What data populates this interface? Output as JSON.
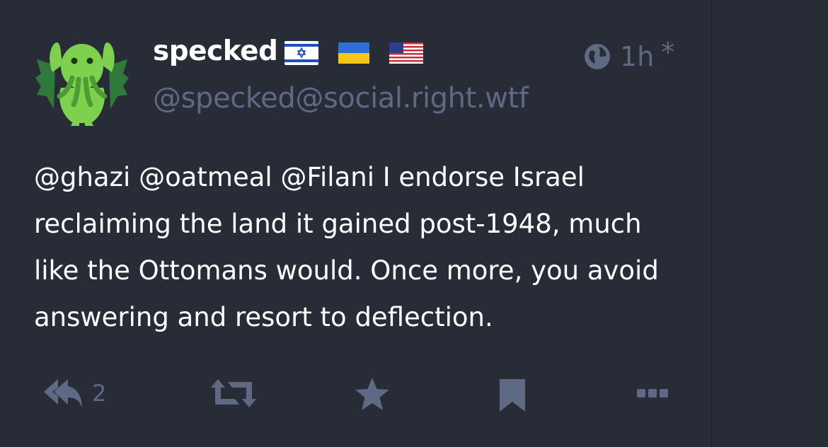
{
  "status": {
    "author": {
      "display_name": "specked",
      "handle": "@specked@social.right.wtf",
      "avatar_icon": "cthulhu-avatar",
      "flags": [
        "israel-flag",
        "ukraine-flag",
        "us-flag"
      ]
    },
    "visibility_icon": "globe-icon",
    "time": "1h",
    "edited_marker": "*",
    "mentions": [
      "@ghazi",
      "@oatmeal",
      "@Filani"
    ],
    "text": "I endorse Israel reclaiming the land it gained post-1948, much like the Ottomans would. Once more, you avoid answering and resort to deflection.",
    "reply_count": "2"
  },
  "actions": [
    "reply-icon",
    "boost-icon",
    "favourite-icon",
    "bookmark-icon",
    "more-icon"
  ],
  "colors": {
    "background": "#282c37",
    "text": "#ffffff",
    "muted": "#606984",
    "avatar_green": "#7ed04f"
  }
}
